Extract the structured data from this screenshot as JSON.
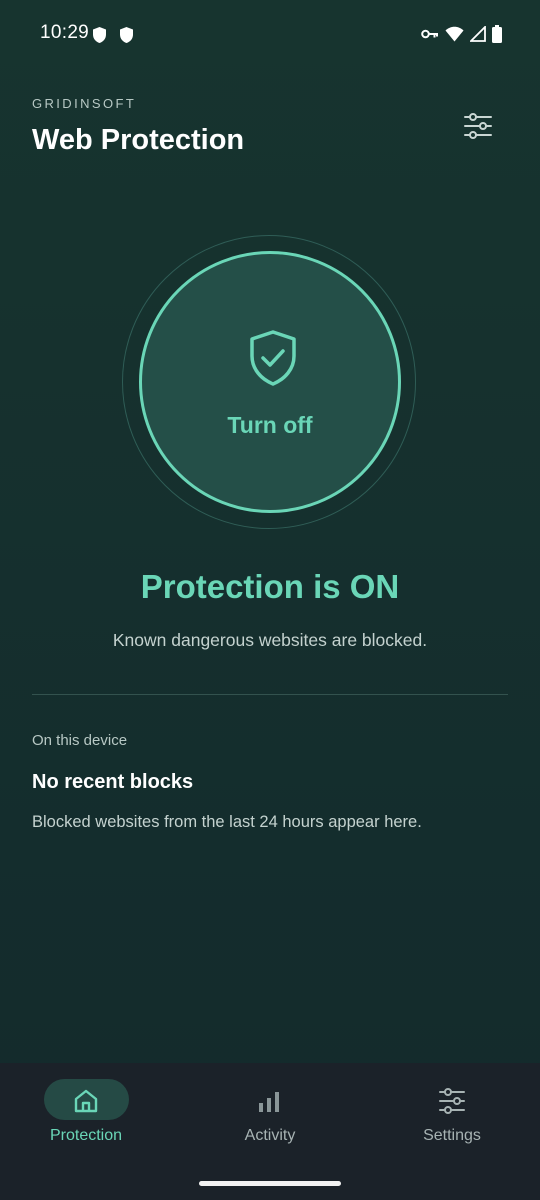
{
  "status_bar": {
    "time": "10:29",
    "left_icons": [
      "shield-icon",
      "shield-icon"
    ],
    "right_icons": [
      "key-icon",
      "wifi-icon",
      "signal-icon",
      "battery-icon"
    ]
  },
  "header": {
    "brand": "GRIDINSOFT",
    "title": "Web Protection",
    "action_icon": "sliders-icon"
  },
  "toggle": {
    "label": "Turn off",
    "icon": "shield-check-icon"
  },
  "protection_status": {
    "heading": "Protection is ON",
    "description": "Known dangerous websites are blocked."
  },
  "device_section": {
    "label": "On this device",
    "heading": "No recent blocks",
    "description": "Blocked websites from the last 24 hours appear here."
  },
  "bottom_nav": {
    "items": [
      {
        "label": "Protection",
        "icon": "home-icon",
        "active": true
      },
      {
        "label": "Activity",
        "icon": "bar-chart-icon",
        "active": false
      },
      {
        "label": "Settings",
        "icon": "sliders-icon",
        "active": false
      }
    ]
  },
  "colors": {
    "background": "#17342f",
    "accent": "#6ad6b7",
    "nav_background": "#1b2229"
  }
}
